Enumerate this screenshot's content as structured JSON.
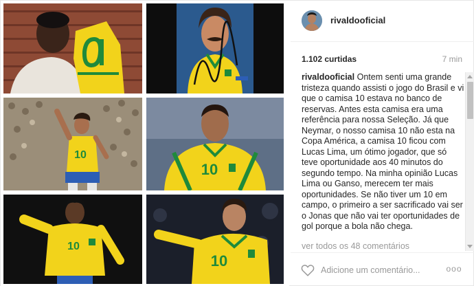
{
  "post": {
    "author": {
      "username": "rivaldooficial"
    },
    "likes_text": "1.102 curtidas",
    "time_ago": "7 min",
    "caption": {
      "username": "rivaldooficial",
      "text": "Ontem senti uma grande tristeza quando assisti o jogo do Brasil e vi que o camisa 10 estava no banco de reservas. Antes esta camisa era uma referência para nossa Seleção. Já que Neymar, o nosso camisa 10 não esta na Copa América, a camisa 10 ficou com Lucas Lima, um ótimo jogador, que só teve oportunidade aos 40 minutos do segundo tempo. Na minha opinião Lucas Lima ou Ganso, merecem ter mais oportunidades. Se não tiver um 10 em campo, o primeiro a ser sacrificado vai ser o Jonas que não vai ter oportunidades de gol porque a bola não chega."
    },
    "view_all_comments": "ver todos os 48 comentários",
    "comment_placeholder": "Adicione um comentário...",
    "more_label": "ooo",
    "photos": [
      {
        "name": "photo-pele-kissing-shirt",
        "jersey_number": "10"
      },
      {
        "name": "photo-rivelino-autograph",
        "jersey_number": ""
      },
      {
        "name": "photo-zico-running",
        "jersey_number": "10"
      },
      {
        "name": "photo-rivaldo-portrait",
        "jersey_number": "10"
      },
      {
        "name": "photo-ronaldinho-playing",
        "jersey_number": "10"
      },
      {
        "name": "photo-kaka-playing",
        "jersey_number": "10"
      }
    ],
    "colors": {
      "brazil_yellow": "#f2d31b",
      "brazil_green": "#1f8a3b",
      "brazil_blue": "#2d5eb5",
      "muted_text": "#999999"
    },
    "icons": {
      "like": "heart-icon",
      "more": "more-options-icon"
    }
  }
}
